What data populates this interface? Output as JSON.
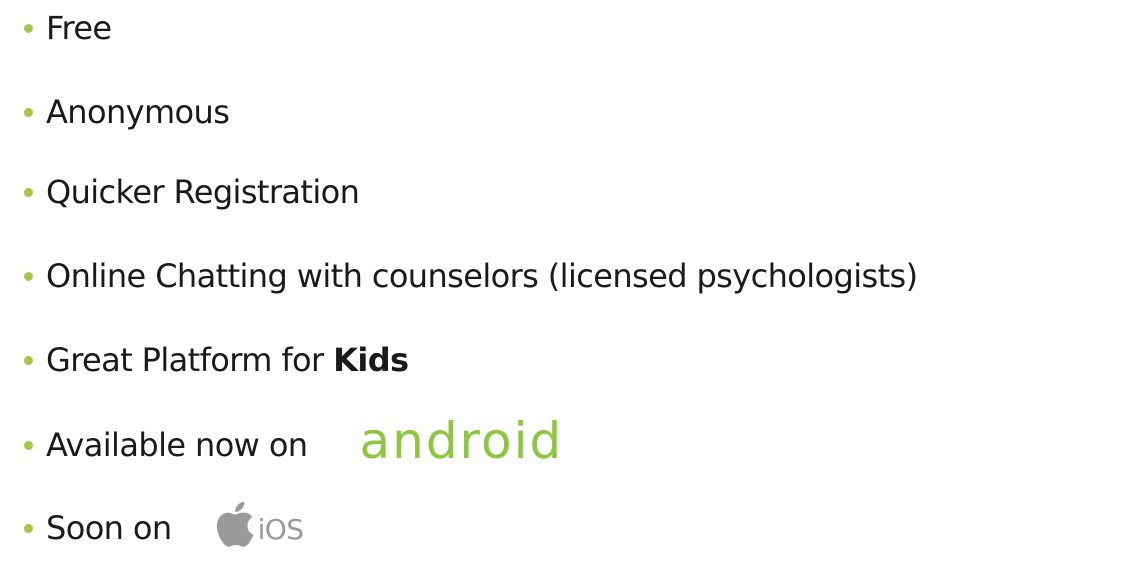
{
  "colors": {
    "bullet": "#a6c646",
    "android": "#8dc63f",
    "ios": "#9a9a9a"
  },
  "items": [
    {
      "text": "Free"
    },
    {
      "text": "Anonymous"
    },
    {
      "text": "Quicker Registration"
    },
    {
      "text": "Online Chatting with counselors (licensed psychologists)"
    },
    {
      "text": "Great Platform for ",
      "bold": "Kids"
    },
    {
      "text": "Available now on",
      "logo_text": "android",
      "logo_icon": "android-logo"
    },
    {
      "text": "Soon on",
      "logo_text": "iOS",
      "logo_icon": "apple-icon"
    }
  ]
}
